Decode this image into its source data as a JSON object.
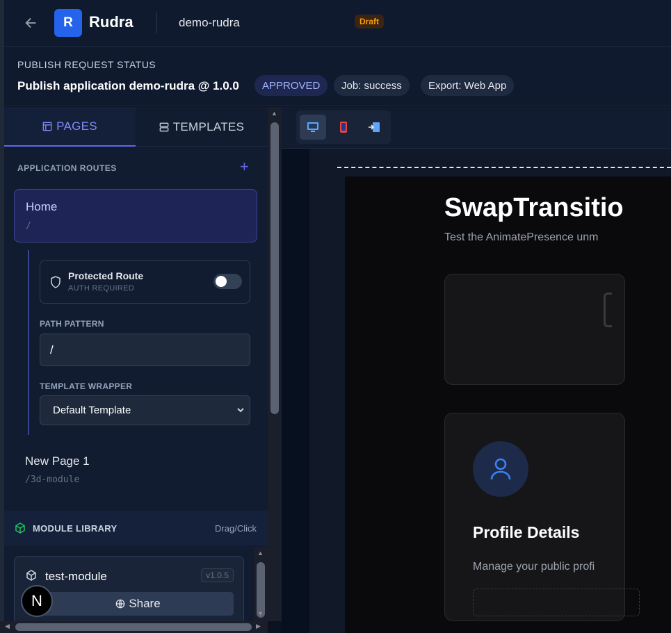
{
  "header": {
    "logo_letter": "R",
    "brand": "Rudra",
    "project": "demo-rudra",
    "status_badge": "Draft"
  },
  "status": {
    "title": "PUBLISH REQUEST STATUS",
    "publish_text": "Publish application demo-rudra @ 1.0.0",
    "approved": "APPROVED",
    "job": "Job: success",
    "export": "Export: Web App"
  },
  "tabs": {
    "pages": "PAGES",
    "templates": "TEMPLATES"
  },
  "routes": {
    "heading": "APPLICATION ROUTES",
    "items": [
      {
        "name": "Home",
        "path": "/"
      },
      {
        "name": "New Page 1",
        "path": "/3d-module"
      }
    ],
    "details": {
      "protected_title": "Protected Route",
      "protected_sub": "AUTH REQUIRED",
      "protected_enabled": false,
      "path_label": "PATH PATTERN",
      "path_value": "/",
      "template_label": "TEMPLATE WRAPPER",
      "template_value": "Default Template"
    }
  },
  "module_library": {
    "title": "MODULE LIBRARY",
    "hint": "Drag/Click",
    "modules": [
      {
        "name": "test-module",
        "version": "v1.0.5",
        "share_label": "Share"
      }
    ]
  },
  "next_badge": "N",
  "preview": {
    "title": "SwapTransitio",
    "subtitle": "Test the AnimatePresence unm",
    "card_title": "Profile Details",
    "card_subtitle": "Manage your public profi"
  },
  "colors": {
    "accent": "#6366f1",
    "brand": "#2563eb",
    "draft": "#f59e0b",
    "module_icon": "#22c55e"
  }
}
